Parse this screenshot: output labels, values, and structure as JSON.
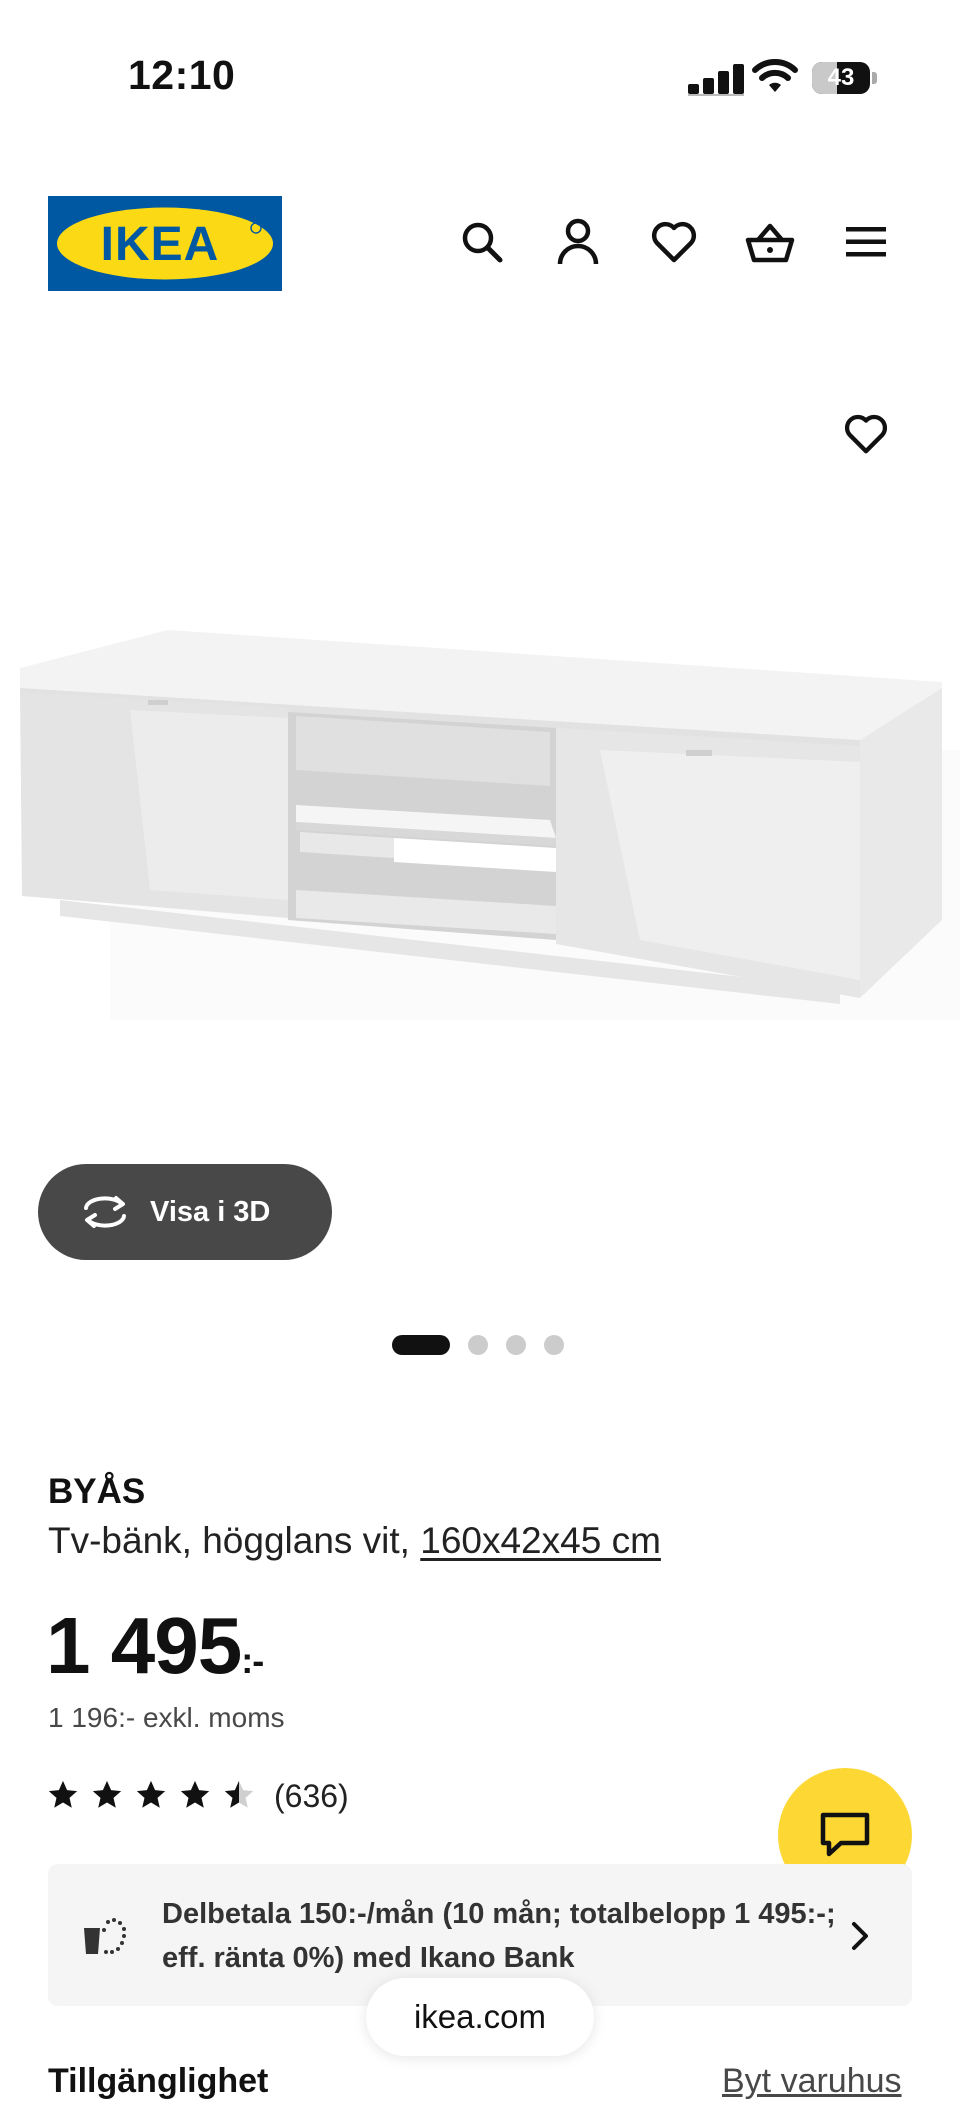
{
  "status_bar": {
    "time": "12:10",
    "battery": "43",
    "battery_level": 0.43
  },
  "header": {
    "logo_text": "IKEA",
    "colors": {
      "brand_blue": "#0058a3",
      "brand_yellow": "#fbd914"
    },
    "icons": [
      "search-icon",
      "user-icon",
      "heart-icon",
      "basket-icon",
      "menu-icon"
    ]
  },
  "gallery": {
    "view_3d_label": "Visa i 3D",
    "dots_total": 4,
    "active_index": 0
  },
  "product": {
    "name": "BYÅS",
    "desc_prefix": "Tv-bänk, högglans vit, ",
    "desc_link": "160x42x45 cm",
    "price": "1 495",
    "price_suffix": ":-",
    "price_excl_vat": "1 196:- exkl. moms",
    "rating_value": 4.5,
    "rating_max": 5,
    "review_count": "(636)"
  },
  "finance": {
    "text": "Delbetala 150:-/mån (10 mån; totalbelopp 1 495:-; eff. ränta 0%) med Ikano Bank"
  },
  "browser": {
    "url": "ikea.com"
  },
  "sections": {
    "availability": "Tillgänglighet",
    "change_store": "Byt varuhus"
  },
  "colors": {
    "chat_yellow": "#fdd835",
    "button_dark": "#484848"
  }
}
